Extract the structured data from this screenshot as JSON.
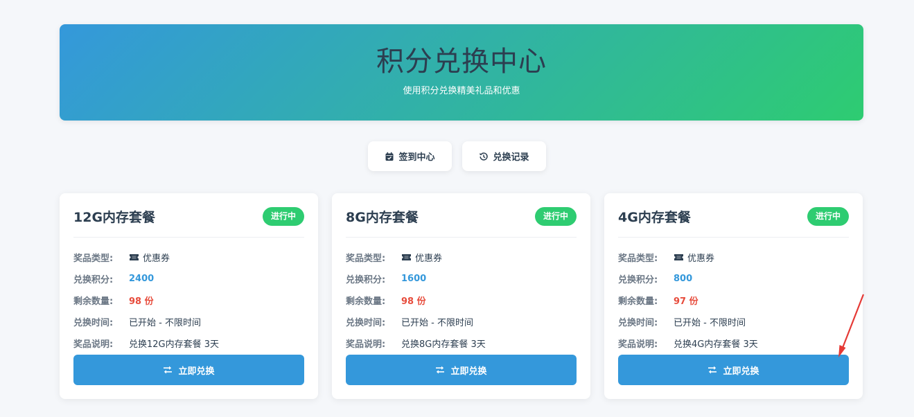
{
  "hero": {
    "title": "积分兑换中心",
    "subtitle": "使用积分兑换精美礼品和优惠"
  },
  "actions": [
    {
      "label": "签到中心",
      "icon": "calendar-check-icon"
    },
    {
      "label": "兑换记录",
      "icon": "history-icon"
    }
  ],
  "labels": {
    "type": "奖品类型:",
    "points": "兑换积分:",
    "remaining": "剩余数量:",
    "time": "兑换时间:",
    "desc": "奖品说明:"
  },
  "cards": [
    {
      "title": "12G内存套餐",
      "status": "进行中",
      "type": "优惠券",
      "points": "2400",
      "remaining": "98 份",
      "time": "已开始 - 不限时间",
      "desc": "兑换12G内存套餐 3天",
      "button": "立即兑换"
    },
    {
      "title": "8G内存套餐",
      "status": "进行中",
      "type": "优惠券",
      "points": "1600",
      "remaining": "98 份",
      "time": "已开始 - 不限时间",
      "desc": "兑换8G内存套餐 3天",
      "button": "立即兑换"
    },
    {
      "title": "4G内存套餐",
      "status": "进行中",
      "type": "优惠券",
      "points": "800",
      "remaining": "97 份",
      "time": "已开始 - 不限时间",
      "desc": "兑换4G内存套餐 3天",
      "button": "立即兑换"
    }
  ],
  "colors": {
    "gradient_start": "#3498db",
    "gradient_end": "#2ecc71",
    "primary": "#3498db",
    "success": "#2ecc71",
    "danger": "#e74c3c",
    "annotation": "#e53935"
  }
}
